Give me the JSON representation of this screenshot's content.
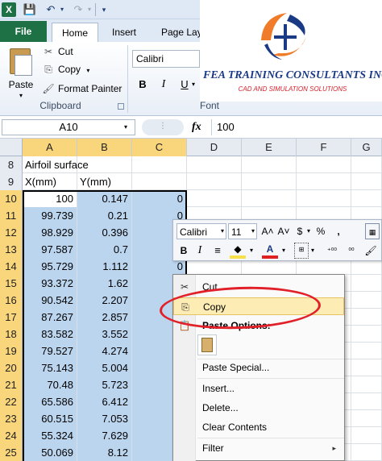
{
  "qat": {
    "app_icon": "X",
    "save": "💾",
    "undo": "↶",
    "redo": "↷",
    "dropdown": "▾",
    "customize": "▾"
  },
  "tabs": {
    "file": "File",
    "home": "Home",
    "insert": "Insert",
    "page_layout": "Page Lay"
  },
  "ribbon": {
    "paste": "Paste",
    "paste_drop": "▾",
    "cut": "Cut",
    "cut_icon": "✂",
    "copy": "Copy",
    "copy_icon": "⎘",
    "copy_drop": "▾",
    "format_painter": "Format Painter",
    "format_painter_icon": "🖌",
    "clipboard_group": "Clipboard",
    "launcher": "↘",
    "font_name": "Calibri",
    "bold": "B",
    "italic": "I",
    "underline": "U",
    "underline_drop": "▾",
    "font_group": "Font"
  },
  "logo": {
    "title": "FEA TRAINING CONSULTANTS INC.",
    "subtitle": "CAD AND SIMULATION SOLUTIONS",
    "colors": {
      "orange": "#f07c2a",
      "blue": "#1b3a86",
      "red": "#d9202a"
    }
  },
  "formula_bar": {
    "name_box": "A10",
    "name_drop": "▾",
    "dots": "⋮",
    "fx": "fx",
    "value": "100"
  },
  "columns": [
    "A",
    "B",
    "C",
    "D",
    "E",
    "F",
    "G"
  ],
  "selected_columns": [
    "A",
    "B",
    "C"
  ],
  "rows": [
    {
      "num": "8",
      "a": "Airfoil surface",
      "b": "",
      "c": ""
    },
    {
      "num": "9",
      "a": "X(mm)",
      "b": "Y(mm)",
      "c": ""
    },
    {
      "num": "10",
      "a": "100",
      "b": "0.147",
      "c": "0"
    },
    {
      "num": "11",
      "a": "99.739",
      "b": "0.21",
      "c": "0"
    },
    {
      "num": "12",
      "a": "98.929",
      "b": "0.396",
      "c": "0"
    },
    {
      "num": "13",
      "a": "97.587",
      "b": "0.7",
      "c": "0"
    },
    {
      "num": "14",
      "a": "95.729",
      "b": "1.112",
      "c": "0"
    },
    {
      "num": "15",
      "a": "93.372",
      "b": "1.62",
      "c": ""
    },
    {
      "num": "16",
      "a": "90.542",
      "b": "2.207",
      "c": ""
    },
    {
      "num": "17",
      "a": "87.267",
      "b": "2.857",
      "c": ""
    },
    {
      "num": "18",
      "a": "83.582",
      "b": "3.552",
      "c": ""
    },
    {
      "num": "19",
      "a": "79.527",
      "b": "4.274",
      "c": ""
    },
    {
      "num": "20",
      "a": "75.143",
      "b": "5.004",
      "c": ""
    },
    {
      "num": "21",
      "a": "70.48",
      "b": "5.723",
      "c": ""
    },
    {
      "num": "22",
      "a": "65.586",
      "b": "6.412",
      "c": ""
    },
    {
      "num": "23",
      "a": "60.515",
      "b": "7.053",
      "c": ""
    },
    {
      "num": "24",
      "a": "55.324",
      "b": "7.629",
      "c": ""
    },
    {
      "num": "25",
      "a": "50.069",
      "b": "8.12",
      "c": ""
    }
  ],
  "mini_toolbar": {
    "font": "Calibri",
    "size": "11",
    "drop": "▾",
    "grow": "A˄",
    "shrink": "A˅",
    "currency": "$",
    "percent": "%",
    "comma": ",",
    "format_table": "▦",
    "bold": "B",
    "italic": "I",
    "center": "≡",
    "fill": "◆",
    "font_color": "A",
    "borders": "⊞",
    "inc_decimal": "⁺⁰⁰",
    "dec_decimal": "⁰⁰",
    "painter": "🖌"
  },
  "context_menu": {
    "cut": "Cut",
    "cut_icon": "✂",
    "copy": "Copy",
    "copy_icon": "⎘",
    "paste_options": "Paste Options:",
    "paste_options_icon": "📋",
    "paste_special": "Paste Special...",
    "insert": "Insert...",
    "delete": "Delete...",
    "clear_contents": "Clear Contents",
    "filter": "Filter",
    "arrow": "▸"
  }
}
